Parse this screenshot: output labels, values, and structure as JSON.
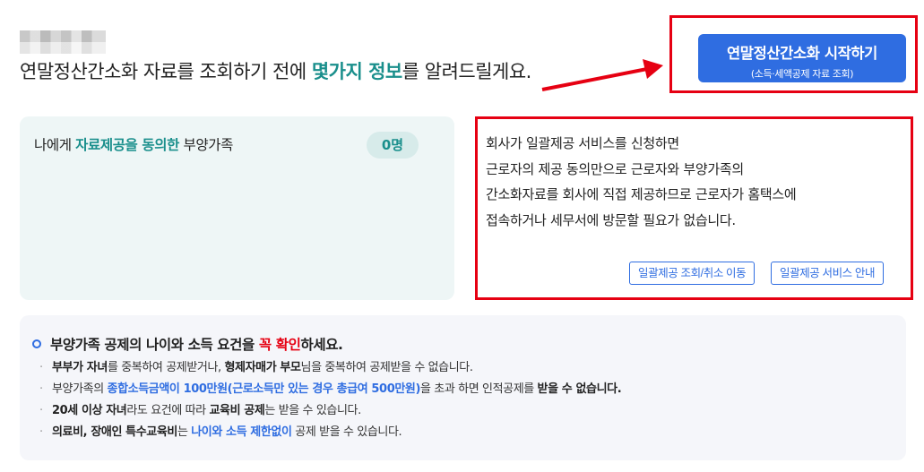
{
  "header": {
    "headline_before": "연말정산간소화 자료를 조회하기 전에 ",
    "headline_highlight": "몇가지 정보",
    "headline_after": "를 알려드릴게요."
  },
  "start_button": {
    "label": "연말정산간소화 시작하기",
    "sublabel": "(소득·세액공제 자료 조회)"
  },
  "dependents": {
    "label_before": "나에게 ",
    "label_highlight": "자료제공을 동의한",
    "label_after": " 부양가족",
    "count": "0명"
  },
  "info": {
    "lines": [
      "회사가 일괄제공 서비스를 신청하면",
      "근로자의 제공 동의만으로 근로자와 부양가족의",
      "간소화자료를 회사에 직접 제공하므로 근로자가 홈택스에",
      "접속하거나 세무서에 방문할 필요가 없습니다."
    ],
    "button1": "일괄제공 조회/취소 이동",
    "button2": "일괄제공 서비스 안내"
  },
  "notice": {
    "title_before": "부양가족 공제의 나이와 소득 요건을 ",
    "title_red": "꼭 확인",
    "title_after": "하세요.",
    "item1": {
      "p1": "부부가 자녀",
      "p2": "를 중복하여 공제받거나, ",
      "p3": "형제자매가 부모",
      "p4": "님을 중복하여 공제받을 수 없습니다."
    },
    "item2": {
      "p1": "부양가족의 ",
      "p2": "종합소득금액이 100만원(근로소득만 있는 경우 총급여 500만원)",
      "p3": "을 초과 하면 인적공제를 ",
      "p4": "받을 수 없습니다."
    },
    "item3": {
      "p1": "20세 이상 자녀",
      "p2": "라도 요건에 따라 ",
      "p3": "교육비 공제",
      "p4": "는 받을 수 있습니다."
    },
    "item4": {
      "p1": "의료비, 장애인 특수교육비",
      "p2": "는 ",
      "p3": "나이와 소득 제한없이",
      "p4": " 공제 받을 수 있습니다."
    }
  },
  "colors": {
    "accent_teal": "#1a8f8c",
    "primary_blue": "#2f6de1",
    "annotation_red": "#e60012"
  }
}
